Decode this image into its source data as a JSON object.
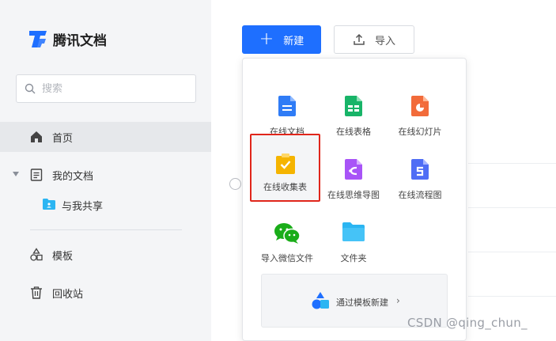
{
  "app": {
    "name": "腾讯文档",
    "brand_color": "#1e6fff"
  },
  "search": {
    "placeholder": "搜索"
  },
  "sidebar": {
    "items": [
      {
        "label": "首页",
        "icon": "home-icon",
        "active": true
      },
      {
        "label": "我的文档",
        "icon": "document-icon",
        "expandable": true
      },
      {
        "label": "与我共享",
        "icon": "shared-folder-icon"
      },
      {
        "label": "模板",
        "icon": "template-shapes-icon"
      },
      {
        "label": "回收站",
        "icon": "trash-icon"
      }
    ]
  },
  "toolbar": {
    "new_label": "新建",
    "import_label": "导入"
  },
  "new_menu": {
    "items": [
      {
        "label": "在线文档",
        "icon": "online-doc-icon",
        "color": "#2f7cf6"
      },
      {
        "label": "在线表格",
        "icon": "online-sheet-icon",
        "color": "#18b468"
      },
      {
        "label": "在线幻灯片",
        "icon": "online-slides-icon",
        "color": "#f26b3a"
      },
      {
        "label": "在线收集表",
        "icon": "online-form-icon",
        "color": "#f5b400",
        "highlighted": true
      },
      {
        "label": "在线思维导图",
        "icon": "mind-map-icon",
        "color": "#a854f7"
      },
      {
        "label": "在线流程图",
        "icon": "flowchart-icon",
        "color": "#4f6df5"
      },
      {
        "label": "导入微信文件",
        "icon": "wechat-icon",
        "color": "#1aad19"
      },
      {
        "label": "文件夹",
        "icon": "folder-icon",
        "color": "#2bb5f2"
      }
    ],
    "template_banner": {
      "label": "通过模板新建",
      "chevron": "›"
    }
  },
  "watermark": "CSDN @qing_chun_"
}
